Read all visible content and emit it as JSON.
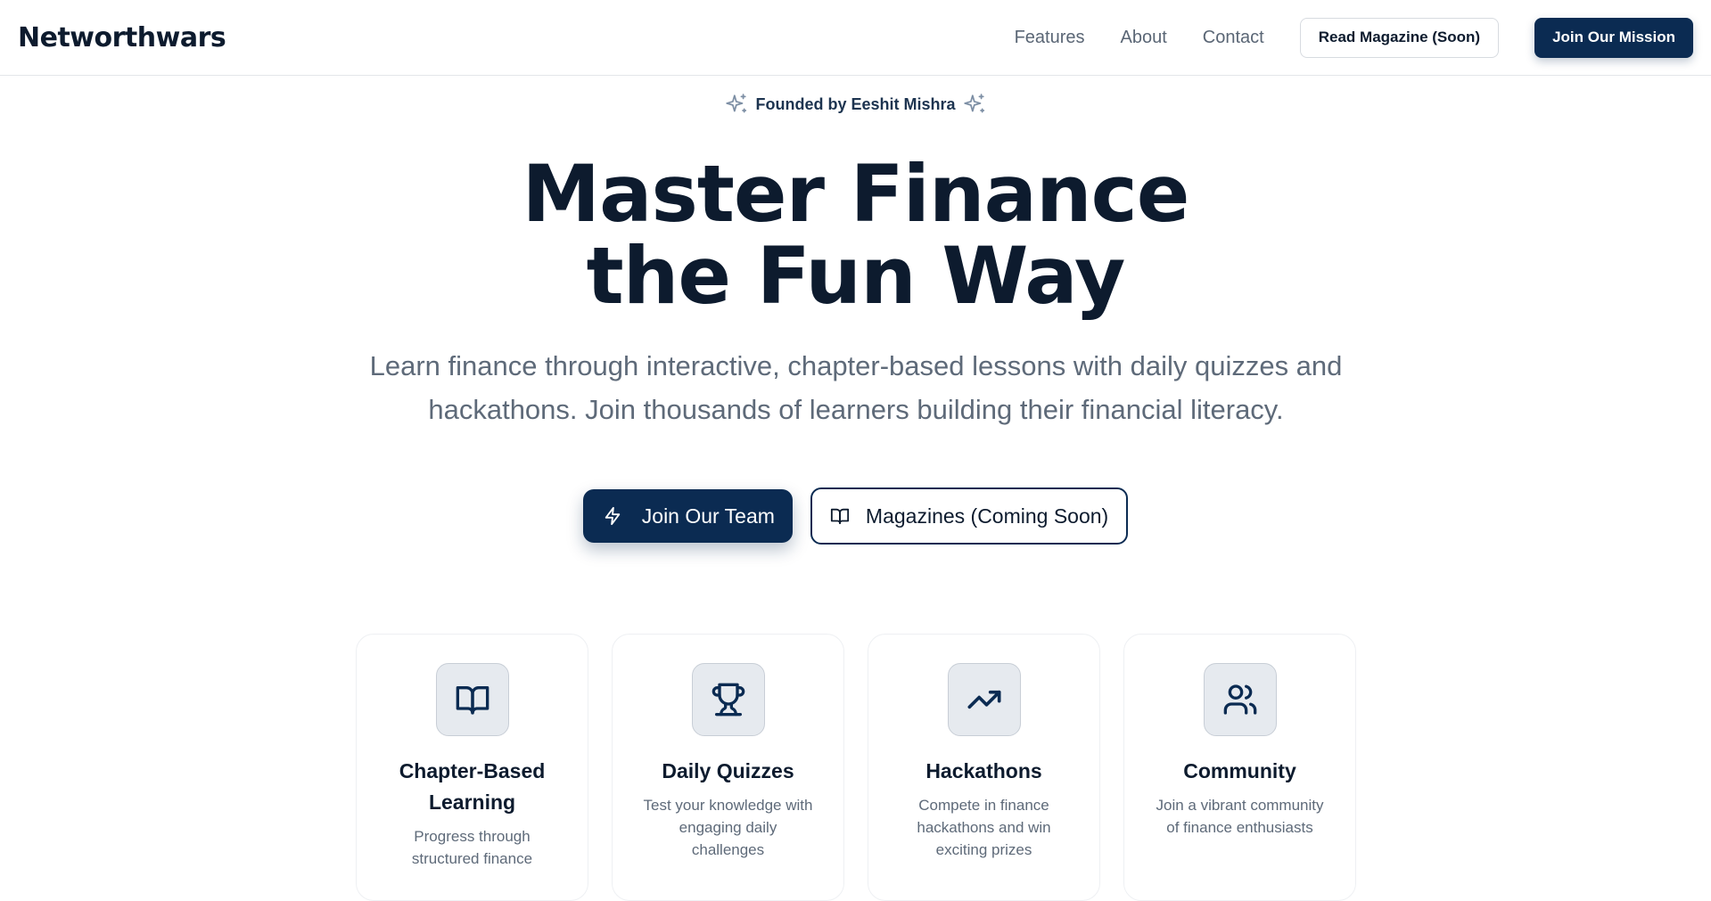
{
  "navbar": {
    "brand": "Networthwars",
    "links": [
      "Features",
      "About",
      "Contact"
    ],
    "read_magazine_label": "Read Magazine (Soon)",
    "join_mission_label": "Join Our Mission"
  },
  "hero": {
    "founded_text": "Founded by Eeshit Mishra",
    "headline_line1": "Master Finance",
    "headline_line2": "the Fun Way",
    "subtitle": "Learn finance through interactive, chapter-based lessons with daily quizzes and hackathons. Join thousands of learners building their financial literacy.",
    "primary_cta": "Join Our Team",
    "secondary_cta": "Magazines (Coming Soon)"
  },
  "features": [
    {
      "icon": "book-open-icon",
      "title": "Chapter-Based Learning",
      "desc": "Progress through structured finance"
    },
    {
      "icon": "trophy-icon",
      "title": "Daily Quizzes",
      "desc": "Test your knowledge with engaging daily challenges"
    },
    {
      "icon": "trending-up-icon",
      "title": "Hackathons",
      "desc": "Compete in finance hackathons and win exciting prizes"
    },
    {
      "icon": "users-icon",
      "title": "Community",
      "desc": "Join a vibrant community of finance enthusiasts"
    }
  ],
  "colors": {
    "primary": "#0b2b52",
    "text_dark": "#0d1b2e",
    "text_muted": "#5e6a79",
    "icon_bg": "#e6eaef"
  }
}
